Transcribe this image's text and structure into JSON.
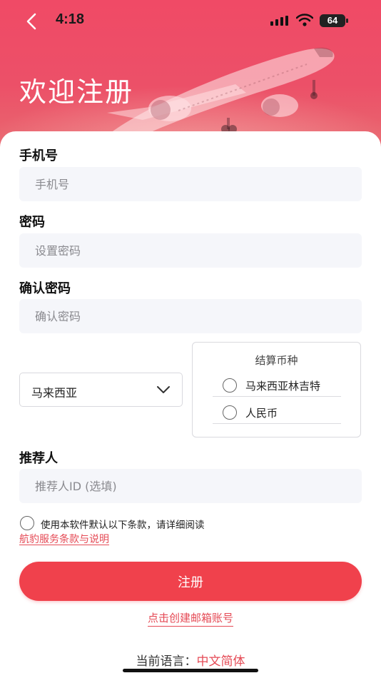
{
  "status_bar": {
    "time": "4:18",
    "battery": "64"
  },
  "header": {
    "title": "欢迎注册"
  },
  "form": {
    "phone": {
      "label": "手机号",
      "placeholder": "手机号"
    },
    "password": {
      "label": "密码",
      "placeholder": "设置密码"
    },
    "confirm_password": {
      "label": "确认密码",
      "placeholder": "确认密码"
    },
    "country": {
      "selected": "马来西亚"
    },
    "currency": {
      "title": "结算币种",
      "options": [
        "马来西亚林吉特",
        "人民币"
      ]
    },
    "referrer": {
      "label": "推荐人",
      "placeholder": "推荐人ID (选填)"
    }
  },
  "terms": {
    "text": "使用本软件默认以下条款，请详细阅读",
    "link": "航豹服务条款与说明"
  },
  "actions": {
    "register_label": "注册",
    "email_register_link": "点击创建邮箱账号"
  },
  "language": {
    "label": "当前语言：",
    "value": "中文简体"
  },
  "colors": {
    "accent": "#f0414c",
    "header_bg": "#f04a66",
    "link": "#e54a55"
  }
}
